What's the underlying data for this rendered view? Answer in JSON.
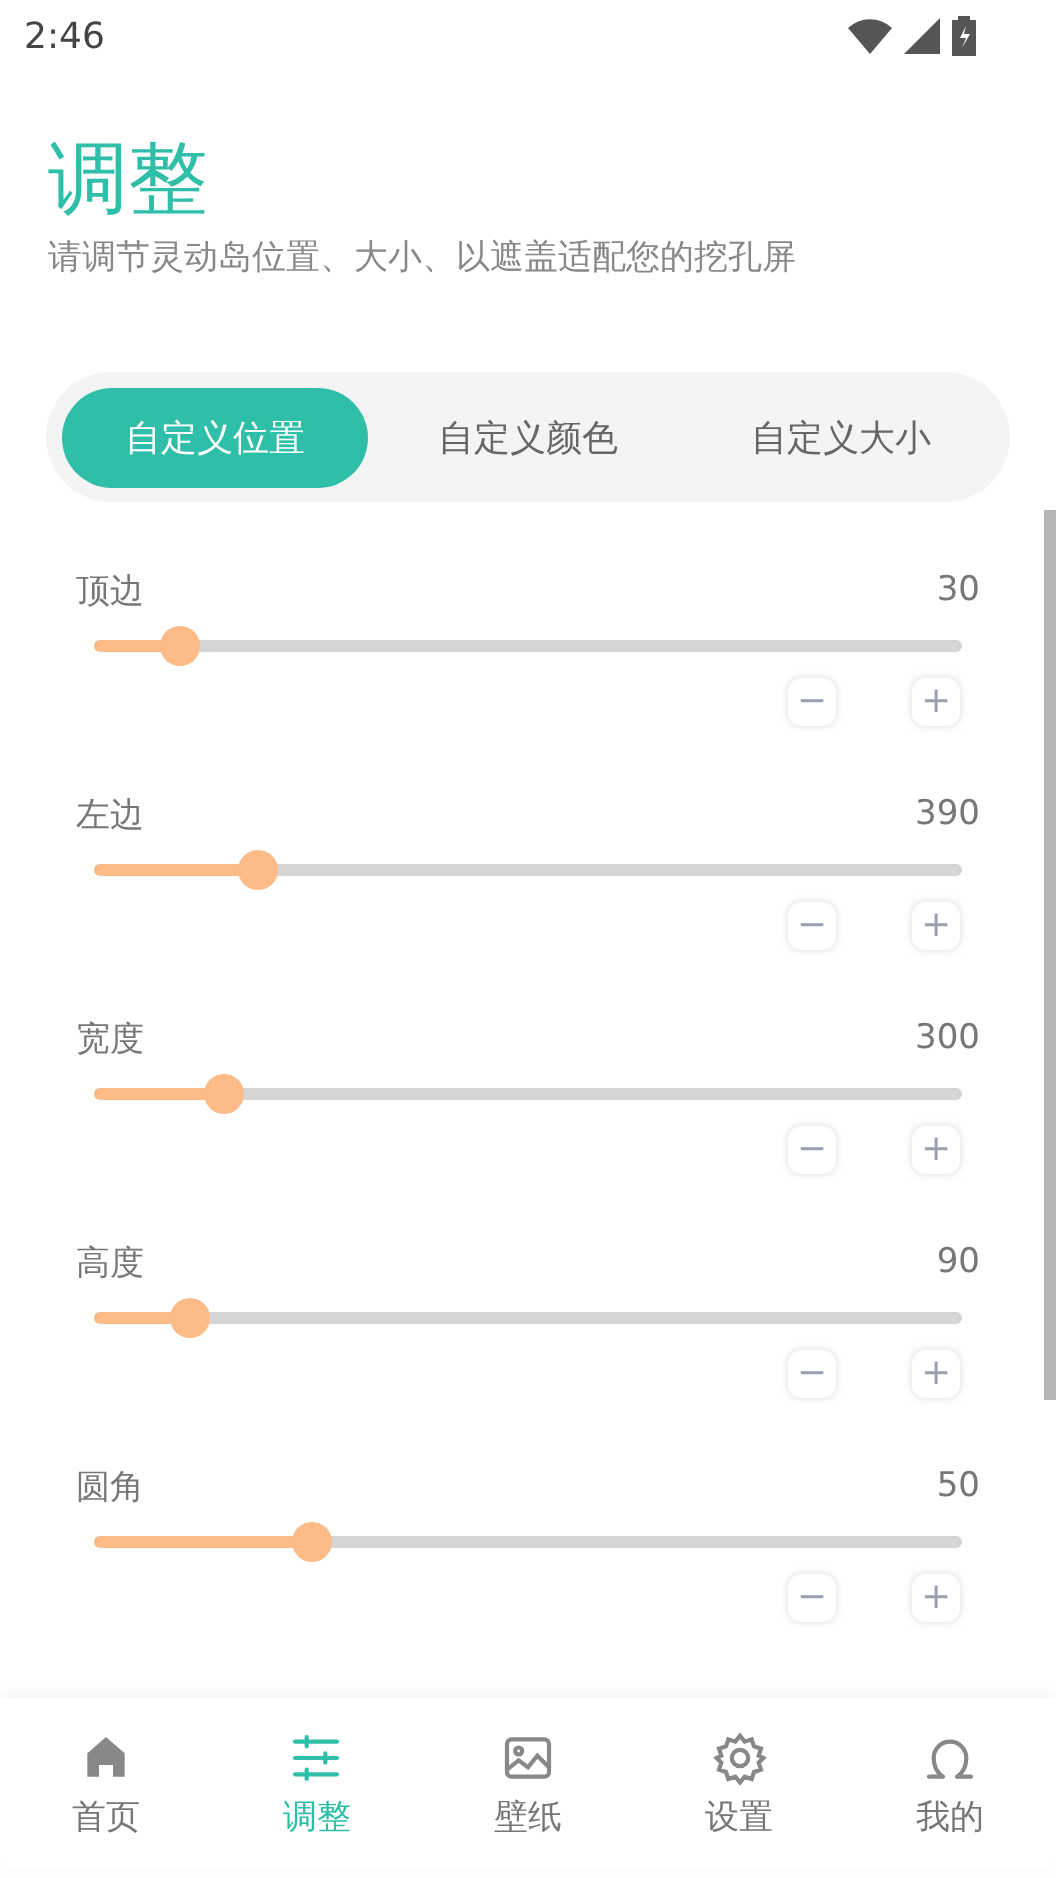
{
  "status_bar": {
    "time": "2:46"
  },
  "header": {
    "title": "调整",
    "subtitle": "请调节灵动岛位置、大小、以遮盖适配您的挖孔屏"
  },
  "tabs": [
    {
      "label": "自定义位置",
      "selected": true
    },
    {
      "label": "自定义颜色",
      "selected": false
    },
    {
      "label": "自定义大小",
      "selected": false
    }
  ],
  "sliders": [
    {
      "label": "顶边",
      "reading": "30",
      "level": 0.1,
      "minus": "−",
      "plus": "+"
    },
    {
      "label": "左边",
      "reading": "390",
      "level": 0.19,
      "minus": "−",
      "plus": "+"
    },
    {
      "label": "宽度",
      "reading": "300",
      "level": 0.15,
      "minus": "−",
      "plus": "+"
    },
    {
      "label": "高度",
      "reading": "90",
      "level": 0.11,
      "minus": "−",
      "plus": "+"
    },
    {
      "label": "圆角",
      "reading": "50",
      "level": 0.25,
      "minus": "−",
      "plus": "+"
    }
  ],
  "bottom_nav": [
    {
      "kind": "home",
      "label": "首页",
      "selected": false
    },
    {
      "kind": "adjust",
      "label": "调整",
      "selected": true
    },
    {
      "kind": "wallpaper",
      "label": "壁纸",
      "selected": false
    },
    {
      "kind": "settings",
      "label": "设置",
      "selected": false
    },
    {
      "kind": "profile",
      "label": "我的",
      "selected": false
    }
  ]
}
